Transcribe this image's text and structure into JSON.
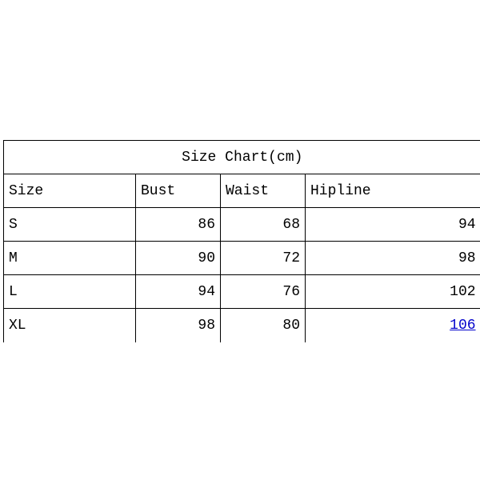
{
  "chart_data": {
    "type": "table",
    "title": "Size Chart(cm)",
    "columns": [
      "Size",
      "Bust",
      "Waist",
      "Hipline"
    ],
    "rows": [
      {
        "size": "S",
        "bust": 86,
        "waist": 68,
        "hipline": 94
      },
      {
        "size": "M",
        "bust": 90,
        "waist": 72,
        "hipline": 98
      },
      {
        "size": "L",
        "bust": 94,
        "waist": 76,
        "hipline": 102
      },
      {
        "size": "XL",
        "bust": 98,
        "waist": 80,
        "hipline": 106
      }
    ],
    "linked_cell": {
      "row": 3,
      "col": "hipline"
    }
  }
}
